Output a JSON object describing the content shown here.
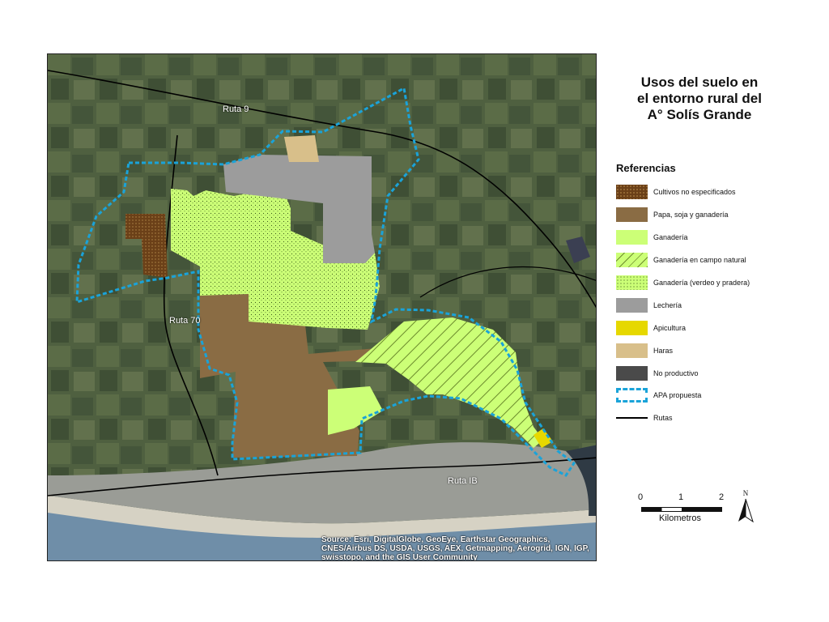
{
  "title": {
    "lines": [
      "Usos del suelo en",
      "el entorno rural del",
      "A° Solís Grande"
    ]
  },
  "legend": {
    "heading": "Referencias",
    "items": [
      {
        "label": "Cultivos no especificados",
        "color": "#6b4018",
        "pattern": "dots"
      },
      {
        "label": "Papa, soja y ganadería",
        "color": "#8a6c44",
        "pattern": "solid"
      },
      {
        "label": "Ganadería",
        "color": "#ccff77",
        "pattern": "solid"
      },
      {
        "label": "Ganadería en campo natural",
        "color": "#ccff77",
        "pattern": "hatch"
      },
      {
        "label": "Ganadería (verdeo y pradera)",
        "color": "#ccff77",
        "pattern": "stipple"
      },
      {
        "label": "Lechería",
        "color": "#9c9c9c",
        "pattern": "solid"
      },
      {
        "label": "Apicultura",
        "color": "#e6d800",
        "pattern": "solid"
      },
      {
        "label": "Haras",
        "color": "#d8bf8a",
        "pattern": "solid"
      },
      {
        "label": "No productivo",
        "color": "#4a4a4a",
        "pattern": "solid"
      },
      {
        "label": "APA propuesta",
        "color": "#1aa3d9",
        "pattern": "dashed-outline"
      },
      {
        "label": "Rutas",
        "color": "#000000",
        "pattern": "line"
      }
    ]
  },
  "map": {
    "road_labels": [
      "Ruta 9",
      "Ruta 70",
      "Ruta IB"
    ],
    "attribution": "Source: Esri, DigitalGlobe, GeoEye, Earthstar Geographics, CNES/Airbus DS, USDA, USGS, AEX, Getmapping, Aerogrid, IGN, IGP, swisstopo, and the GIS User Community"
  },
  "scale": {
    "ticks": [
      "0",
      "1",
      "2"
    ],
    "unit": "Kilometros"
  },
  "north": "N"
}
